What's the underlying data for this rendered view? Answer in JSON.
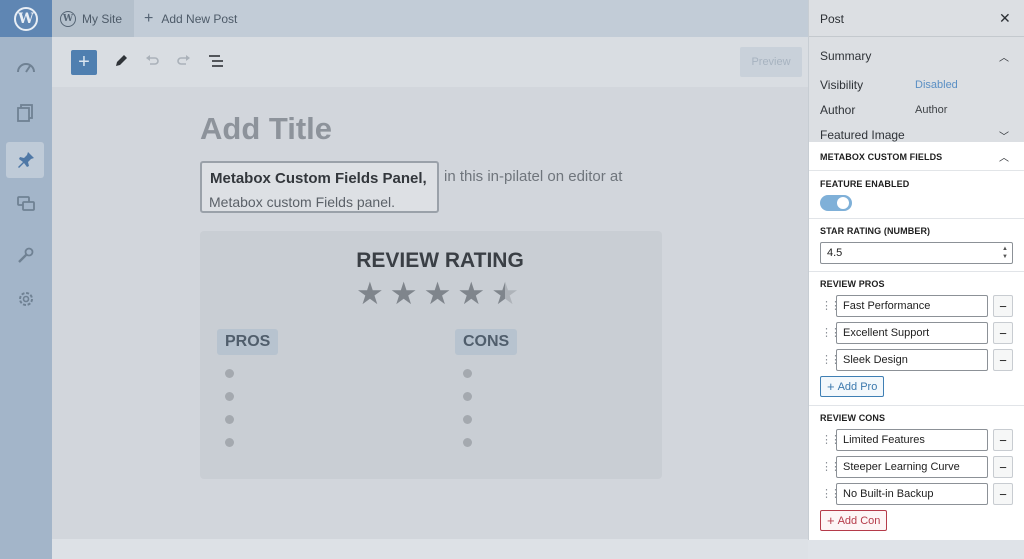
{
  "topbar": {
    "site_name": "My Site",
    "add_new": "Add New Post"
  },
  "toolbar": {
    "preview_label": "Preview"
  },
  "editor": {
    "title_placeholder": "Add Title",
    "highlight_line1": "Metabox Custom Fields Panel,",
    "highlight_line2": "Metabox custom Fields panel.",
    "paragraph_rest": "in this in-pilatel on editor at"
  },
  "review_card": {
    "title": "REVIEW RATING",
    "rating": 4.5,
    "max_stars": 5,
    "pros_label": "PROS",
    "cons_label": "CONS",
    "pros_bullets": 4,
    "cons_bullets": 4
  },
  "sidebar": {
    "title": "Post",
    "summary_label": "Summary",
    "visibility_label": "Visibility",
    "visibility_value": "Disabled",
    "author_label": "Author",
    "author_value": "Author",
    "featured_image_label": "Featured Image",
    "metabox": {
      "title": "METABOX CUSTOM FIELDS",
      "feature_enabled_label": "FEATURE ENABLED",
      "feature_enabled": true,
      "star_rating_label": "STAR RATING (NUMBER)",
      "star_rating_value": "4.5",
      "pros_label": "REVIEW PROS",
      "pros": [
        "Fast Performance",
        "Excellent Support",
        "Sleek Design"
      ],
      "add_pro_label": "Add Pro",
      "cons_label": "REVIEW CONS",
      "cons": [
        "Limited Features",
        "Steeper Learning Curve",
        "No Built-in Backup"
      ],
      "add_con_label": "Add Con"
    }
  },
  "colors": {
    "admin_bar": "#a3b5c9",
    "accent": "#3b78ad",
    "danger": "#b53b4a",
    "toggle_on": "#7fb0d8"
  }
}
